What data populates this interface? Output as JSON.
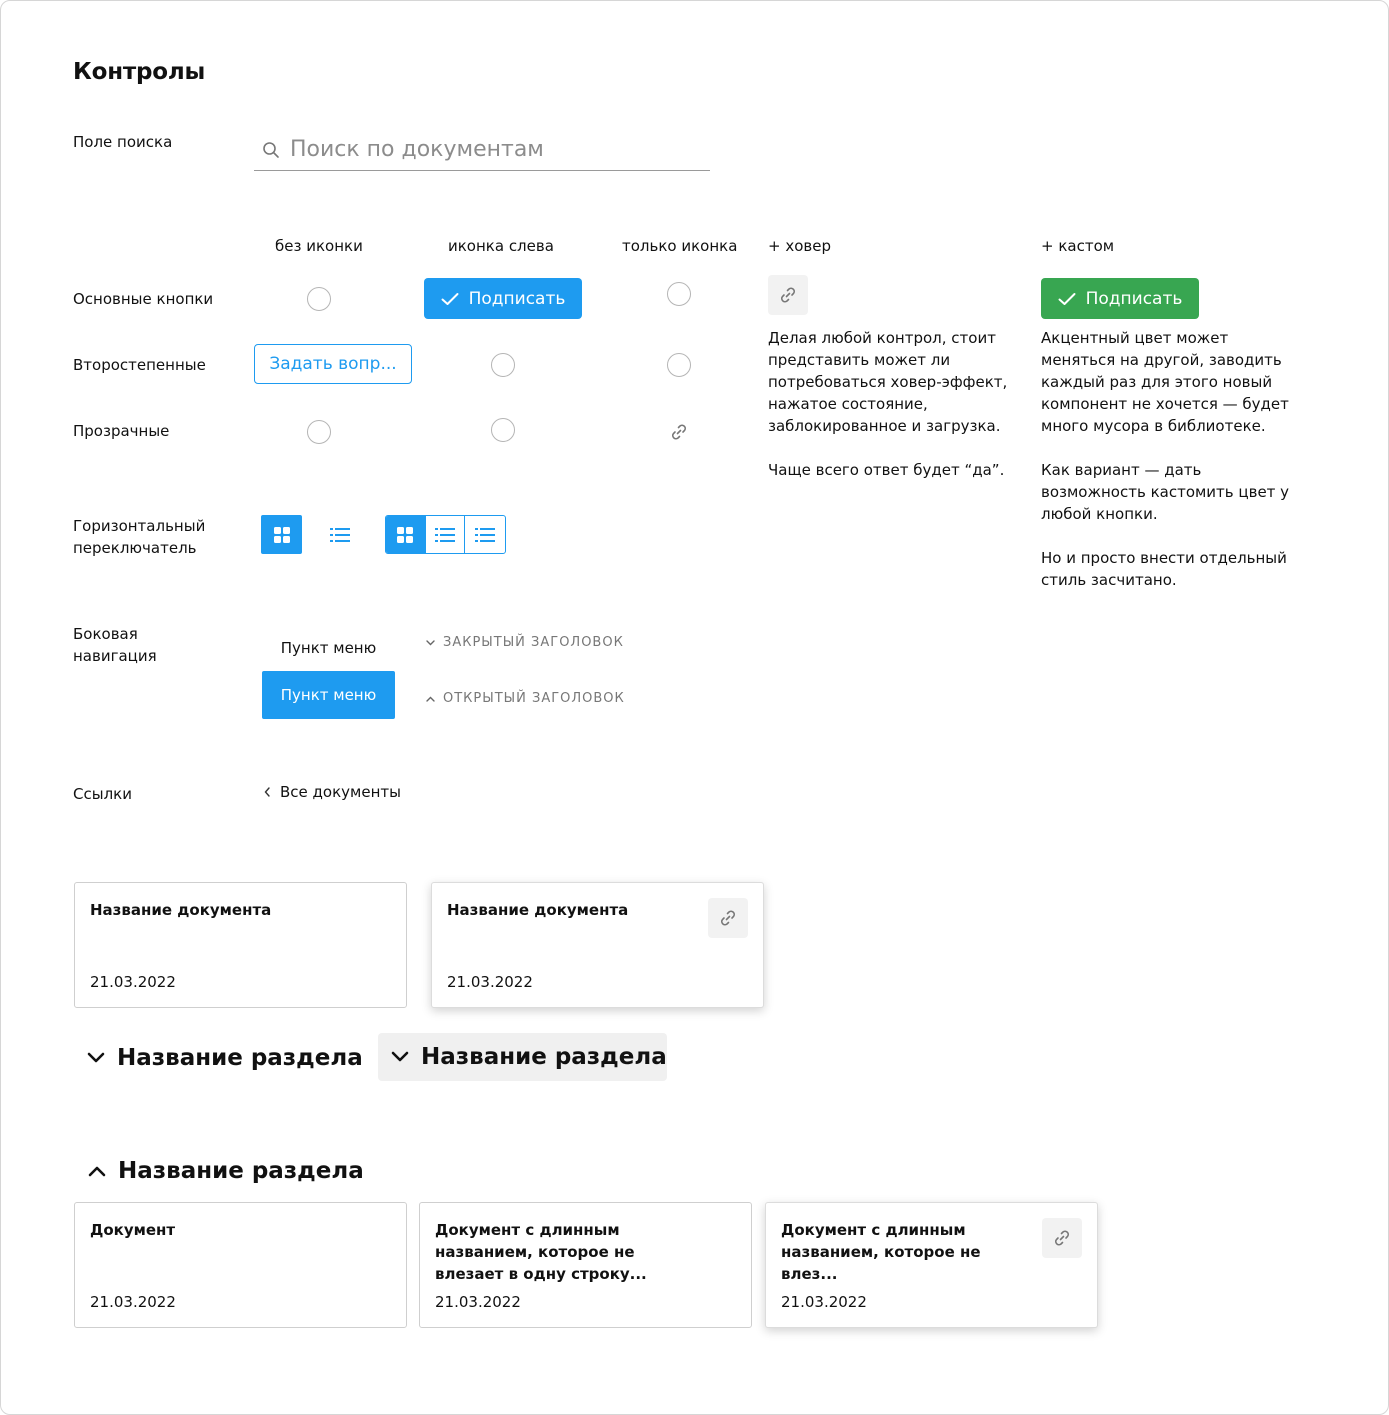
{
  "page": {
    "title": "Контролы"
  },
  "search": {
    "label": "Поле поиска",
    "placeholder": "Поиск по документам"
  },
  "columns": {
    "no_icon": "без иконки",
    "icon_left": "иконка слева",
    "icon_only": "только иконка",
    "hover": "+ ховер",
    "custom": "+ кастом"
  },
  "rows": {
    "primary": "Основные кнопки",
    "secondary": "Второстепенные",
    "transparent": "Прозрачные"
  },
  "buttons": {
    "primary_label": "Подписать",
    "secondary_label": "Задать вопр...",
    "custom_label": "Подписать"
  },
  "notes": {
    "hover_1": "Делая любой контрол, стоит представить может ли потребоваться ховер-эффект, нажатое состояние, заблокированное и загрузка.",
    "hover_2": "Чаще всего ответ будет “да”.",
    "custom_1": "Акцентный цвет может меняться на другой, заводить каждый раз для этого новый компонент не хочется — будет много мусора в библиотеке.",
    "custom_2": "Как вариант — дать возможность кастомить цвет у любой кнопки.",
    "custom_3": "Но и просто внести отдельный стиль засчитано."
  },
  "switcher": {
    "label": "Горизонтальный переключатель"
  },
  "sidenav": {
    "label": "Боковая навигация",
    "item": "Пункт меню",
    "item_active": "Пункт меню",
    "closed_header": "ЗАКРЫТЫЙ ЗАГОЛОВОК",
    "open_header": "ОТКРЫТЫЙ ЗАГОЛОВОК"
  },
  "links": {
    "label": "Ссылки",
    "back_link": "Все документы"
  },
  "cards_top": [
    {
      "title": "Название документа",
      "date": "21.03.2022"
    },
    {
      "title": "Название документа",
      "date": "21.03.2022"
    }
  ],
  "sections": {
    "collapsed": "Название раздела",
    "collapsed_hover": "Название раздела",
    "expanded": "Название раздела"
  },
  "cards_bottom": [
    {
      "title": "Документ",
      "date": "21.03.2022"
    },
    {
      "title": "Документ с длинным названием, которое не влезает в одну строку...",
      "date": "21.03.2022"
    },
    {
      "title": "Документ с длинным названием, которое не влез...",
      "date": "21.03.2022"
    }
  ],
  "colors": {
    "accent": "#1e9bf0",
    "custom_accent": "#38a651",
    "hover_bg": "#f2f2f2"
  }
}
